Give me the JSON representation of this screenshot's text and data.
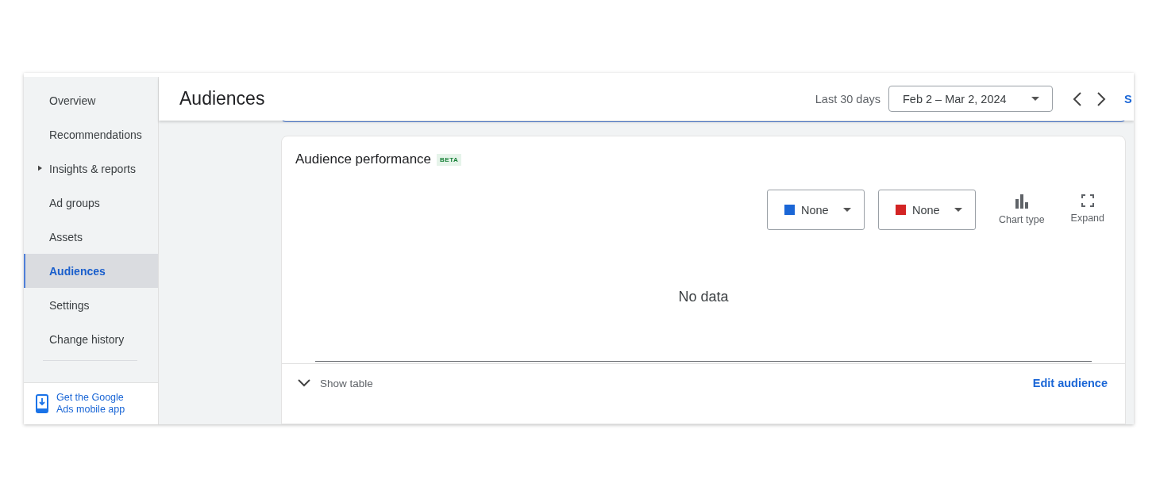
{
  "sidebar": {
    "items": [
      {
        "label": "Overview",
        "selected": false
      },
      {
        "label": "Recommendations",
        "selected": false
      },
      {
        "label": "Insights & reports",
        "selected": false,
        "expanded": false
      },
      {
        "label": "Ad groups",
        "selected": false
      },
      {
        "label": "Assets",
        "selected": false
      },
      {
        "label": "Audiences",
        "selected": true
      },
      {
        "label": "Settings",
        "selected": false
      },
      {
        "label": "Change history",
        "selected": false
      }
    ],
    "promo": {
      "link": "Get the Google Ads mobile app"
    }
  },
  "header": {
    "title": "Audiences",
    "range_label": "Last 30 days",
    "date_range": "Feb 2 – Mar 2, 2024",
    "cut_link": "S"
  },
  "card": {
    "title": "Audience performance",
    "badge": "BETA",
    "metrics": [
      {
        "label": "None",
        "color": "#1a66d6"
      },
      {
        "label": "None",
        "color": "#d32424"
      }
    ],
    "tools": [
      {
        "kind": "chart-type",
        "label": "Chart type"
      },
      {
        "kind": "expand",
        "label": "Expand"
      }
    ],
    "empty_text": "No data",
    "footer": {
      "toggle": "Show table",
      "expanded": false,
      "link": "Edit audience"
    }
  }
}
